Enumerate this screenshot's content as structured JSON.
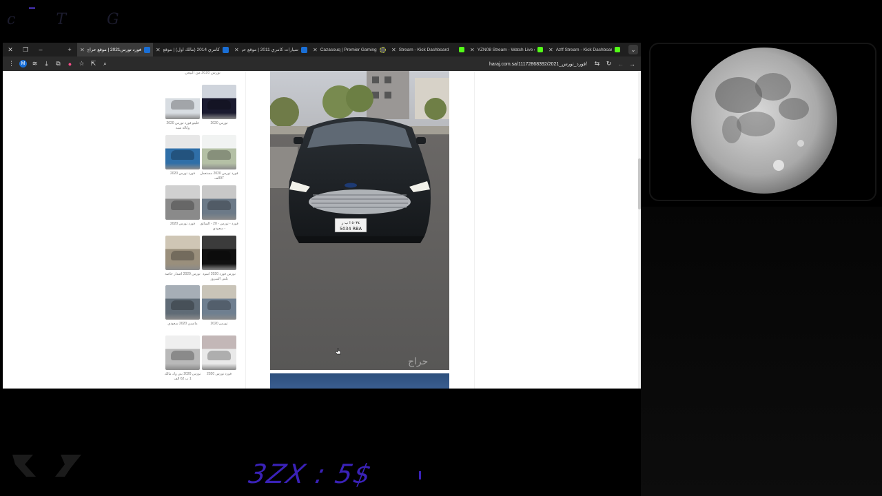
{
  "overlay": {
    "top_watermark": "c T G",
    "donation_text": "3ZX : 5$"
  },
  "browser": {
    "tabs": [
      {
        "label": "",
        "type": "window-control",
        "icon": "close-icon"
      },
      {
        "label": "فورد تورس2021 | موقع حراج",
        "active": true,
        "favicon": "blue"
      },
      {
        "label": "كامري 2014 (مالك اول) | موقع ح...",
        "favicon": "blue"
      },
      {
        "label": "سيارات كامري 2011 | موقع حراج",
        "favicon": "blue"
      },
      {
        "label": "Cazasouq | Premier Gaming Ho",
        "favicon": "circle"
      },
      {
        "label": "Stream - Kick Dashboard",
        "favicon": "kick"
      },
      {
        "label": "YZN08 Stream - Watch Live on",
        "favicon": "kick"
      },
      {
        "label": "Azff Stream - Kick Dashboard",
        "favicon": "kick"
      }
    ],
    "url": "haraj.com.sa/11172868392/فورد_تورس_2021/",
    "avatar_letter": "M"
  },
  "sidebar": {
    "header_caption": "تورس 2020 من البيعي",
    "thumbs": [
      {
        "caption": "تورس 2020",
        "colors": [
          "#1b1b30",
          "#cfd4dc"
        ]
      },
      {
        "caption": "فليتو فورد تورس 2020 وكالة شبه",
        "colors": [
          "#d8dde2",
          "#ffffff"
        ]
      },
      {
        "caption": "فورد تورس 2020 مستعمل 97الف",
        "colors": [
          "#b4c0a5",
          "#f1f3f2"
        ]
      },
      {
        "caption": "فورد تورس 2020",
        "colors": [
          "#2f6fa8",
          "#e7e7e7"
        ]
      },
      {
        "caption": "فورد - تورس - 20 - السائق - سعودي",
        "colors": [
          "#6c7a88",
          "#c8c8c8"
        ]
      },
      {
        "caption": "فورد تورس 2020",
        "colors": [
          "#8a8a8a",
          "#d0d0d0"
        ]
      },
      {
        "caption": "تورس فورد 2020 اسود بلس السرور",
        "colors": [
          "#101010",
          "#3b3b3b"
        ]
      },
      {
        "caption": "تورس 2020 اصدار خاصة",
        "colors": [
          "#9a8f7c",
          "#cfc6b5"
        ]
      },
      {
        "caption": "تورس 2020",
        "colors": [
          "#6f7f90",
          "#c9c4b8"
        ]
      },
      {
        "caption": "ماتسي 2020 سعودي",
        "colors": [
          "#5f6b76",
          "#a6aeb6"
        ]
      },
      {
        "caption": "فورد تورس 2020",
        "colors": [
          "#e9e9e9",
          "#c3b7b7"
        ]
      },
      {
        "caption": "تورس 2020 بني وك مالك 1 ب 62 الف",
        "colors": [
          "#b9b9b9",
          "#efefef"
        ]
      }
    ]
  },
  "main": {
    "photo_watermark": "حراج",
    "plate_top": "٥٠٣٤ ا ب ر",
    "plate_bottom": "5034 RBA"
  }
}
